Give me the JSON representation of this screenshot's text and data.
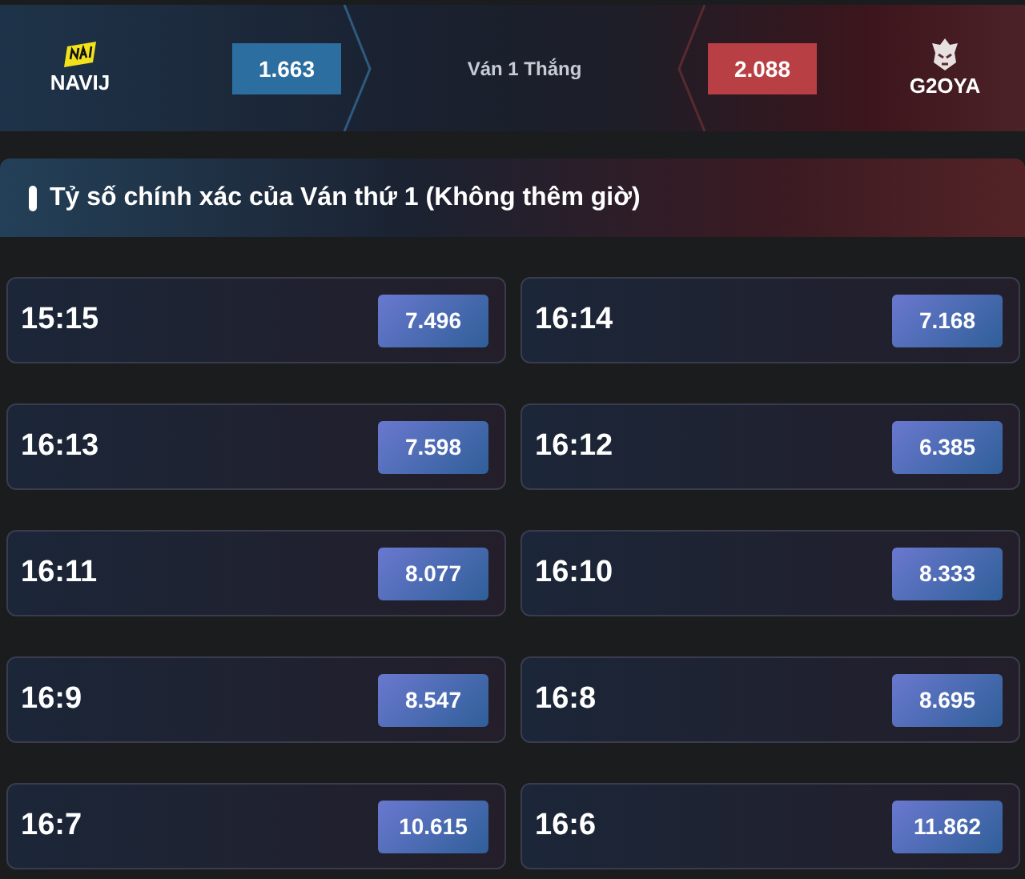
{
  "match": {
    "home": {
      "name": "NAVIJ",
      "odds": "1.663"
    },
    "market": "Ván 1 Thắng",
    "away": {
      "name": "G2OYA",
      "odds": "2.088"
    }
  },
  "section": {
    "title": "Tỷ số chính xác của Ván thứ 1 (Không thêm giờ)"
  },
  "scores": [
    {
      "score": "15:15",
      "odds": "7.496"
    },
    {
      "score": "16:14",
      "odds": "7.168"
    },
    {
      "score": "16:13",
      "odds": "7.598"
    },
    {
      "score": "16:12",
      "odds": "6.385"
    },
    {
      "score": "16:11",
      "odds": "8.077"
    },
    {
      "score": "16:10",
      "odds": "8.333"
    },
    {
      "score": "16:9",
      "odds": "8.547"
    },
    {
      "score": "16:8",
      "odds": "8.695"
    },
    {
      "score": "16:7",
      "odds": "10.615"
    },
    {
      "score": "16:6",
      "odds": "11.862"
    }
  ]
}
